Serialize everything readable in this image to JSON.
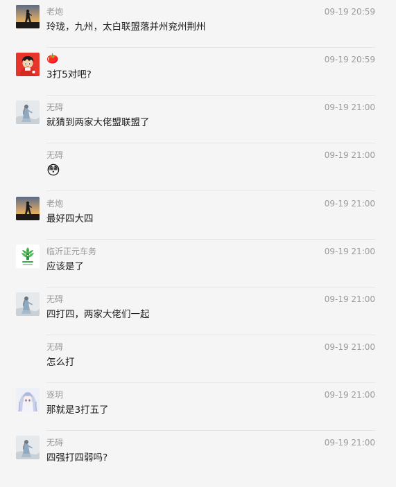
{
  "messages": [
    {
      "sender": "老炮",
      "time": "09-19 20:59",
      "content": "玲珑，九州，太白联盟落并州兖州荆州",
      "avatar_icon": "sunset-silhouette-avatar-icon"
    },
    {
      "sender": "🍅",
      "time": "09-19 20:59",
      "content": "3打5对吧?",
      "avatar_icon": "cartoon-boy-avatar-icon"
    },
    {
      "sender": "无碍",
      "time": "09-19 21:00",
      "content": "就猜到两家大佬盟联盟了",
      "avatar_icon": "sketch-figure-avatar-icon"
    },
    {
      "sender": "无碍",
      "time": "09-19 21:00",
      "content": "😳",
      "avatar_icon": ""
    },
    {
      "sender": "老炮",
      "time": "09-19 21:00",
      "content": "最好四大四",
      "avatar_icon": "sunset-silhouette-avatar-icon"
    },
    {
      "sender": "临沂正元车务",
      "time": "09-19 21:00",
      "content": "应该是了",
      "avatar_icon": "green-leaf-logo-avatar-icon"
    },
    {
      "sender": "无碍",
      "time": "09-19 21:00",
      "content": "四打四，两家大佬们一起",
      "avatar_icon": "sketch-figure-avatar-icon"
    },
    {
      "sender": "无碍",
      "time": "09-19 21:00",
      "content": "怎么打",
      "avatar_icon": ""
    },
    {
      "sender": "逐玥",
      "time": "09-19 21:00",
      "content": "那就是3打五了",
      "avatar_icon": "anime-girl-avatar-icon"
    },
    {
      "sender": "无碍",
      "time": "09-19 21:00",
      "content": "四强打四弱吗?",
      "avatar_icon": "sketch-figure-avatar-icon"
    }
  ],
  "colors": {
    "background": "#f5f5f5",
    "meta_text": "#9a9a9a",
    "body_text": "#1a1a1a",
    "divider": "#e6e6e6"
  }
}
